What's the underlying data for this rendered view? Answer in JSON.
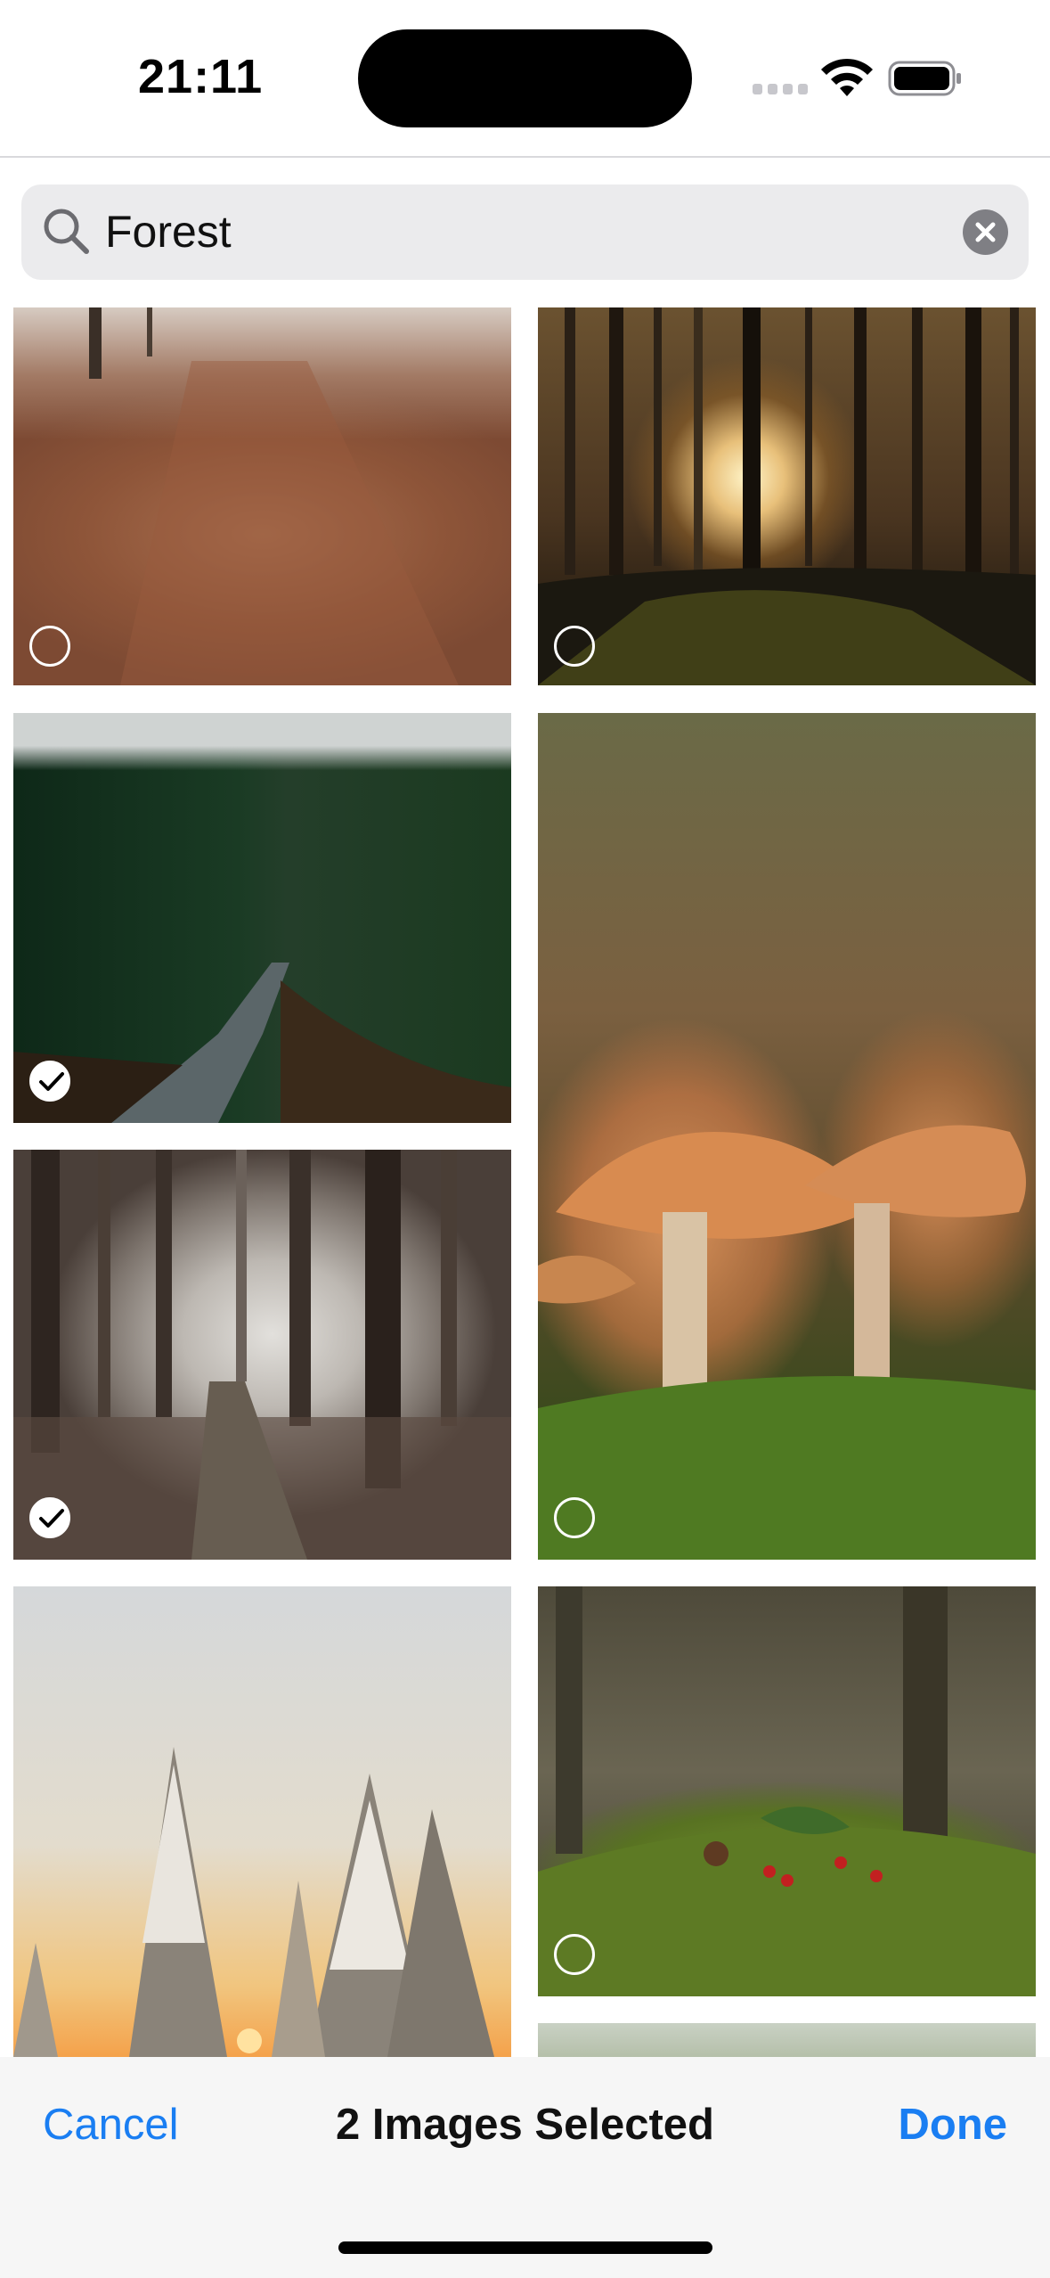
{
  "status_bar": {
    "time": "21:11"
  },
  "search": {
    "value": "Forest",
    "placeholder": "Search"
  },
  "photos": [
    {
      "name": "Leaf-covered forest path",
      "selected": false
    },
    {
      "name": "Sun rays through forest",
      "selected": false
    },
    {
      "name": "Road through pine forest",
      "selected": true
    },
    {
      "name": "Orange mushrooms in moss",
      "selected": false
    },
    {
      "name": "Foggy forest boardwalk",
      "selected": true
    },
    {
      "name": "Snowy trees at sunset",
      "selected": false
    },
    {
      "name": "Moss with heather and berries",
      "selected": false
    },
    {
      "name": "Forest (partially visible)",
      "selected": false
    }
  ],
  "toolbar": {
    "cancel_label": "Cancel",
    "title": "2 Images Selected",
    "done_label": "Done"
  },
  "colors": {
    "accent": "#1a7ef2",
    "toolbar_bg": "#f6f6f6",
    "search_bg": "#ebebed"
  }
}
